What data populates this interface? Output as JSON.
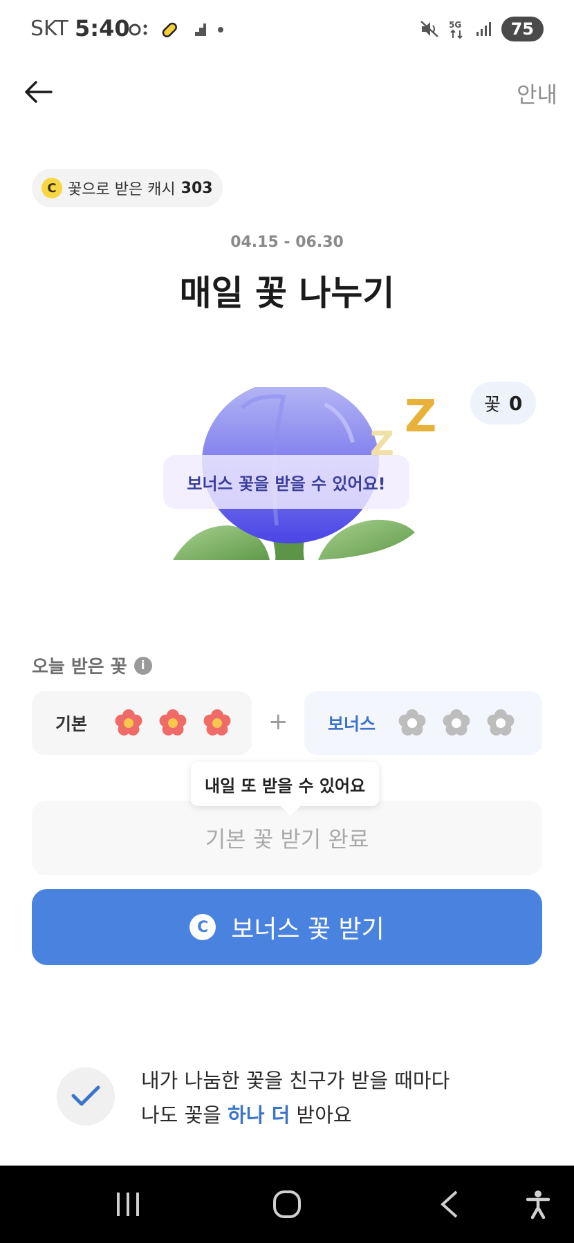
{
  "status_bar": {
    "carrier": "SKT",
    "time": "5:40",
    "battery": "75"
  },
  "header": {
    "guide_label": "안내"
  },
  "cash_chip": {
    "coin_letter": "C",
    "label": "꽃으로 받은 캐시",
    "value": "303"
  },
  "event": {
    "period": "04.15 - 06.30",
    "title": "매일 꽃 나누기"
  },
  "illustration": {
    "count_label": "꽃",
    "count_value": "0",
    "bubble_text": "보너스 꽃을 받을 수 있어요!",
    "z_small": "Z",
    "z_large": "Z"
  },
  "today": {
    "label": "오늘 받은 꽃",
    "info_glyph": "i",
    "basic_label": "기본",
    "basic_received": 3,
    "basic_total": 3,
    "plus": "+",
    "bonus_label": "보너스",
    "bonus_received": 0,
    "bonus_total": 3
  },
  "tooltip": {
    "text": "내일 또 받을 수 있어요"
  },
  "buttons": {
    "done_label": "기본 꽃 받기 완료",
    "bonus_coin": "C",
    "bonus_label": "보너스 꽃 받기"
  },
  "note": {
    "line1": "내가 나눔한 꽃을 친구가 받을 때마다",
    "line2_prefix": "나도 꽃을 ",
    "line2_highlight": "하나 더",
    "line2_suffix": " 받아요"
  },
  "colors": {
    "accent": "#4a83df",
    "accent_text": "#3b73c9",
    "flower_red": "#ef6b67",
    "flower_center": "#f6c64d",
    "flower_gray": "#bdbdbd"
  }
}
